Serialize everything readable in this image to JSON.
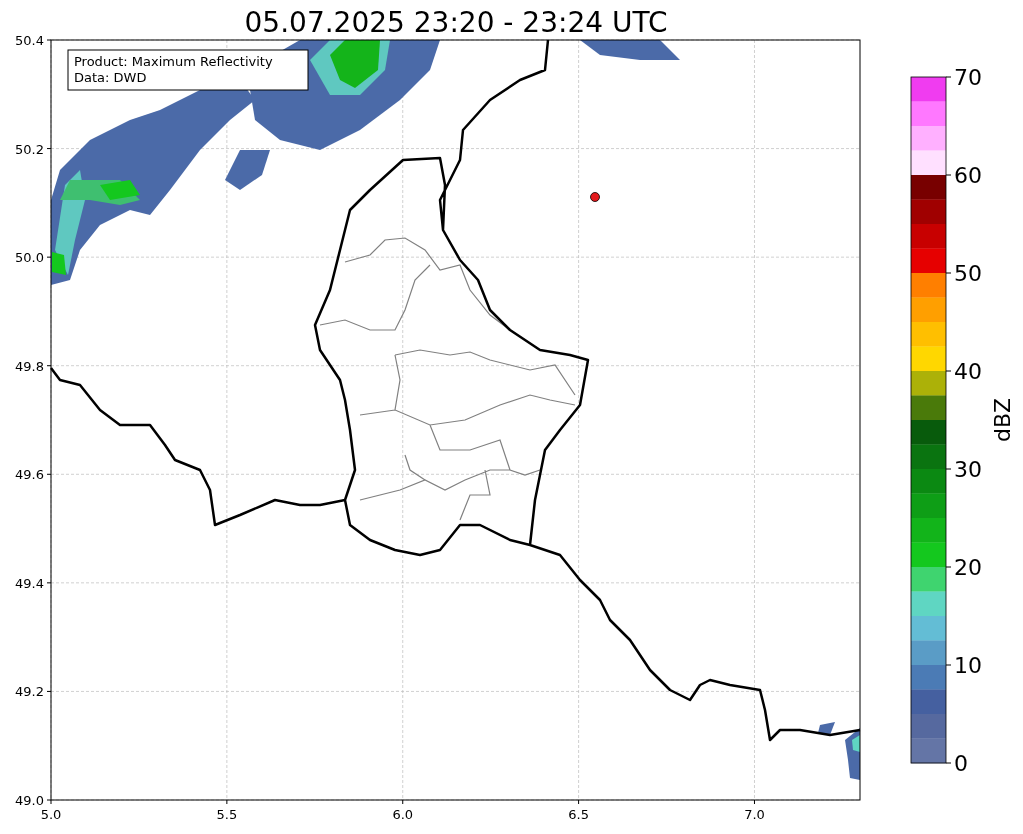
{
  "title": "05.07.2025 23:20 - 23:24 UTC",
  "info_box": {
    "lines": [
      "Product: Maximum Reflectivity",
      "Data: DWD"
    ]
  },
  "map": {
    "yticks": [
      "50.4",
      "50.2",
      "50.0",
      "49.8",
      "49.6",
      "49.4",
      "49.2",
      "49.0"
    ],
    "xticks": [
      "5.0",
      "5.5",
      "6.0",
      "6.5",
      "7.0"
    ]
  },
  "colorbar": {
    "label": "dBZ",
    "ticks": [
      "70",
      "60",
      "50",
      "40",
      "30",
      "20",
      "10",
      "0"
    ],
    "bins": [
      {
        "color": "#f03cf0"
      },
      {
        "color": "#ff78ff"
      },
      {
        "color": "#ffb0ff"
      },
      {
        "color": "#ffe0ff"
      },
      {
        "color": "#780000"
      },
      {
        "color": "#a00000"
      },
      {
        "color": "#c80000"
      },
      {
        "color": "#e60000"
      },
      {
        "color": "#ff7f00"
      },
      {
        "color": "#ff9f00"
      },
      {
        "color": "#ffbf00"
      },
      {
        "color": "#ffd700"
      },
      {
        "color": "#acb108"
      },
      {
        "color": "#4a7a0a"
      },
      {
        "color": "#085b0c"
      },
      {
        "color": "#0a7410"
      },
      {
        "color": "#0b8912"
      },
      {
        "color": "#0e9e16"
      },
      {
        "color": "#12b41a"
      },
      {
        "color": "#14c81e"
      },
      {
        "color": "#3fd46f"
      },
      {
        "color": "#5fd6c2"
      },
      {
        "color": "#63bdd5"
      },
      {
        "color": "#5a9cc6"
      },
      {
        "color": "#4b7bb5"
      },
      {
        "color": "#4560a0"
      },
      {
        "color": "#56699f"
      },
      {
        "color": "#6475a6"
      }
    ]
  }
}
